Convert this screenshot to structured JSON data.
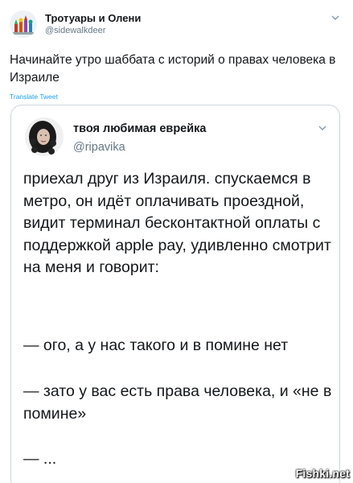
{
  "outer_tweet": {
    "author_name": "Тротуары и Олени",
    "author_handle": "@sidewalkdeer",
    "text": "Начинайте утро шаббата с историй о правах человека в Израиле",
    "translate_label": "Translate Tweet",
    "avatar_icon": "kremlin-avatar-icon",
    "menu_icon": "chevron-down-icon"
  },
  "quoted_tweet": {
    "author_name": "твоя любимая еврейка",
    "author_handle": "@ripavika",
    "avatar_icon": "profile-photo-avatar",
    "menu_icon": "chevron-down-icon",
    "paragraphs": [
      "приехал друг из Израиля. спускаемся в метро, он идёт оплачивать проездной, видит терминал бесконтактной оплаты с поддержкой apple pay, удивленно смотрит на меня и говорит:",
      "— ого, а у нас такого и в помине нет",
      "— зато у вас есть права человека, и «не в помине»",
      "— ..."
    ]
  },
  "watermark": {
    "text": "Fishki.net"
  },
  "colors": {
    "text": "#14171a",
    "secondary": "#657786",
    "link": "#1da1f2",
    "border": "#ccd6dd"
  }
}
